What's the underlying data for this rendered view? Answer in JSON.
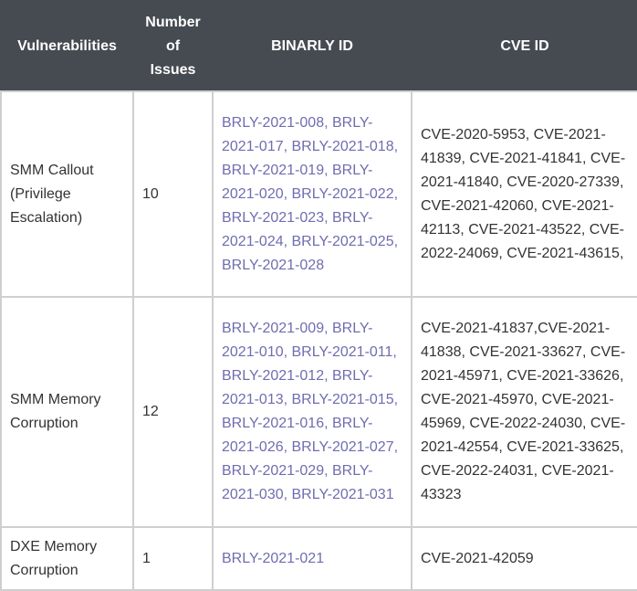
{
  "table": {
    "headers": [
      "Vulnerabilities",
      "Number of Issues",
      "BINARLY ID",
      "CVE ID"
    ],
    "rows": [
      {
        "vulnerability": "SMM Callout (Privilege Escalation)",
        "count": "10",
        "binarly_ids": "BRLY-2021-008, BRLY-2021-017, BRLY-2021-018, BRLY-2021-019, BRLY-2021-020, BRLY-2021-022, BRLY-2021-023, BRLY-2021-024, BRLY-2021-025, BRLY-2021-028",
        "cve_ids": "CVE-2020-5953, CVE-2021-41839, CVE-2021-41841, CVE-2021-41840, CVE-2020-27339, CVE-2021-42060, CVE-2021-42113, CVE-2021-43522, CVE-2022-24069, CVE-2021-43615,"
      },
      {
        "vulnerability": "SMM Memory Corruption",
        "count": "12",
        "binarly_ids": "BRLY-2021-009, BRLY-2021-010, BRLY-2021-011, BRLY-2021-012, BRLY-2021-013, BRLY-2021-015, BRLY-2021-016, BRLY-2021-026, BRLY-2021-027, BRLY-2021-029, BRLY-2021-030, BRLY-2021-031",
        "cve_ids": "CVE-2021-41837,CVE-2021-41838, CVE-2021-33627, CVE-2021-45971, CVE-2021-33626, CVE-2021-45970, CVE-2021-45969, CVE-2022-24030, CVE-2021-42554, CVE-2021-33625, CVE-2022-24031, CVE-2021-43323"
      },
      {
        "vulnerability": "DXE Memory Corruption",
        "count": "1",
        "binarly_ids": "BRLY-2021-021",
        "cve_ids": "CVE-2021-42059"
      }
    ]
  },
  "colors": {
    "header_bg": "#464a51",
    "header_text": "#ffffff",
    "link": "#6f6db0",
    "body_text": "#333333",
    "border": "#cfcfcf"
  }
}
